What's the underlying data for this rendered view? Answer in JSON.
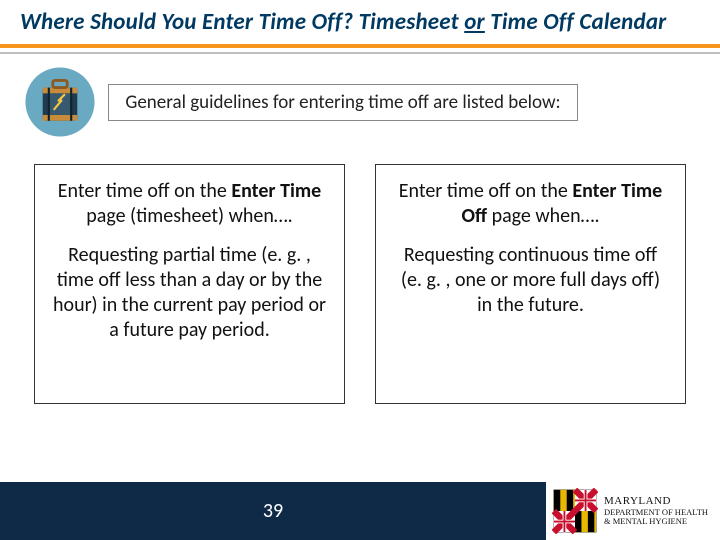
{
  "title": {
    "pre": "Where Should You Enter Time Off? Timesheet ",
    "or": "or",
    "post": " Time Off Calendar"
  },
  "subtitle": "General guidelines for entering time off are listed below:",
  "columns": {
    "left": {
      "lead_pre": "Enter time off on the ",
      "lead_bold": "Enter Time",
      "lead_post": " page (timesheet) when….",
      "body": "Requesting partial time (e. g. , time off less than a day or by the hour) in the current pay period or a future pay period."
    },
    "right": {
      "lead_pre": "Enter time off on the ",
      "lead_bold": "Enter Time Off",
      "lead_post": " page when….",
      "body": "Requesting continuous time off (e. g. , one or more full days off) in the future."
    }
  },
  "footer": {
    "page_number": "39",
    "dept_l1": "MARYLAND",
    "dept_l2": "DEPARTMENT OF HEALTH",
    "dept_l3": "& MENTAL HYGIENE"
  }
}
